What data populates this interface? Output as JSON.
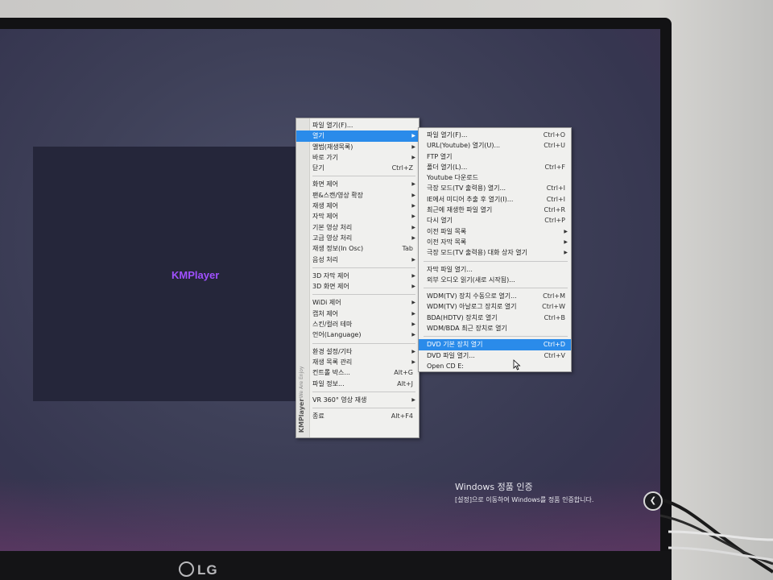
{
  "monitor": {
    "brand": "LG"
  },
  "player": {
    "logo": "KMPlayer"
  },
  "main_menu": {
    "brand": "KMPlayer",
    "brand_small": "We Are Enjoy",
    "items": [
      {
        "label": "파일 열기(F)...",
        "shortcut": "",
        "submenu": false
      },
      {
        "label": "열기",
        "shortcut": "",
        "submenu": true,
        "highlighted": true
      },
      {
        "label": "앨범(재생목록)",
        "shortcut": "",
        "submenu": true
      },
      {
        "label": "바로 가기",
        "shortcut": "",
        "submenu": true
      },
      {
        "label": "닫기",
        "shortcut": "Ctrl+Z",
        "submenu": false
      },
      {
        "sep": true
      },
      {
        "label": "화면 제어",
        "shortcut": "",
        "submenu": true
      },
      {
        "label": "팬&스캔/영상 확장",
        "shortcut": "",
        "submenu": true
      },
      {
        "label": "재생 제어",
        "shortcut": "",
        "submenu": true
      },
      {
        "label": "자막 제어",
        "shortcut": "",
        "submenu": true
      },
      {
        "label": "기본 영상 처리",
        "shortcut": "",
        "submenu": true
      },
      {
        "label": "고급 영상 처리",
        "shortcut": "",
        "submenu": true
      },
      {
        "label": "재생 정보(In Osc)",
        "shortcut": "Tab",
        "submenu": false
      },
      {
        "label": "음성 처리",
        "shortcut": "",
        "submenu": true
      },
      {
        "sep": true
      },
      {
        "label": "3D 자막 제어",
        "shortcut": "",
        "submenu": true
      },
      {
        "label": "3D 화면 제어",
        "shortcut": "",
        "submenu": true
      },
      {
        "sep": true
      },
      {
        "label": "WiDi 제어",
        "shortcut": "",
        "submenu": true
      },
      {
        "label": "캡처 제어",
        "shortcut": "",
        "submenu": true
      },
      {
        "label": "스킨/컬러 테마",
        "shortcut": "",
        "submenu": true
      },
      {
        "label": "언어(Language)",
        "shortcut": "",
        "submenu": true
      },
      {
        "sep": true
      },
      {
        "label": "환경 설정/기타",
        "shortcut": "",
        "submenu": true
      },
      {
        "label": "재생 목록 관리",
        "shortcut": "",
        "submenu": true
      },
      {
        "label": "컨트롤 박스...",
        "shortcut": "Alt+G",
        "submenu": false
      },
      {
        "label": "파일 정보...",
        "shortcut": "Alt+J",
        "submenu": false
      },
      {
        "sep": true
      },
      {
        "label": "VR 360° 영상 재생",
        "shortcut": "",
        "submenu": true
      },
      {
        "sep": true
      },
      {
        "label": "종료",
        "shortcut": "Alt+F4",
        "submenu": false
      }
    ]
  },
  "sub_menu": {
    "items": [
      {
        "label": "파일 열기(F)...",
        "shortcut": "Ctrl+O",
        "submenu": false
      },
      {
        "label": "URL(Youtube) 열기(U)...",
        "shortcut": "Ctrl+U",
        "submenu": false
      },
      {
        "label": "FTP 열기",
        "shortcut": "",
        "submenu": false
      },
      {
        "label": "폴더 열기(L)...",
        "shortcut": "Ctrl+F",
        "submenu": false
      },
      {
        "label": "Youtube 다운로드",
        "shortcut": "",
        "submenu": false
      },
      {
        "label": "극장 모드(TV 출력용) 열기...",
        "shortcut": "Ctrl+I",
        "submenu": false
      },
      {
        "label": "IE에서 미디어 추출 후 열기(I)...",
        "shortcut": "Ctrl+I",
        "submenu": false
      },
      {
        "label": "최근에 재생한 파일 열기",
        "shortcut": "Ctrl+R",
        "submenu": false
      },
      {
        "label": "다시 열기",
        "shortcut": "Ctrl+P",
        "submenu": false
      },
      {
        "label": "이전 파일 목록",
        "shortcut": "",
        "submenu": true
      },
      {
        "label": "이전 자막 목록",
        "shortcut": "",
        "submenu": true
      },
      {
        "label": "극장 모드(TV 출력용) 대화 상자 열기",
        "shortcut": "",
        "submenu": true
      },
      {
        "sep": true
      },
      {
        "label": "자막 파일 열기...",
        "shortcut": "",
        "submenu": false
      },
      {
        "label": "외부 오디오 읽기(새로 시작됨)...",
        "shortcut": "",
        "submenu": false
      },
      {
        "sep": true
      },
      {
        "label": "WDM(TV) 장치 수동으로 열기...",
        "shortcut": "Ctrl+M",
        "submenu": false
      },
      {
        "label": "WDM(TV) 아날로그 장치로 열기",
        "shortcut": "Ctrl+W",
        "submenu": false
      },
      {
        "label": "BDA(HDTV) 장치로 열기",
        "shortcut": "Ctrl+B",
        "submenu": false
      },
      {
        "label": "WDM/BDA 최근 장치로 열기",
        "shortcut": "",
        "submenu": false
      },
      {
        "sep": true
      },
      {
        "label": "DVD 기본 장치 열기",
        "shortcut": "Ctrl+D",
        "submenu": false,
        "highlighted": true
      },
      {
        "label": "DVD 파일 열기...",
        "shortcut": "Ctrl+V",
        "submenu": false
      },
      {
        "label": "Open CD E:",
        "shortcut": "",
        "submenu": false
      }
    ]
  },
  "activation": {
    "title": "Windows 정품 인증",
    "subtitle": "[설정]으로 이동하여 Windows를 정품 인증합니다."
  },
  "colors": {
    "highlight": "#2a8bea",
    "player_logo": "#a050ff",
    "menu_bg": "#f0f0ee"
  }
}
